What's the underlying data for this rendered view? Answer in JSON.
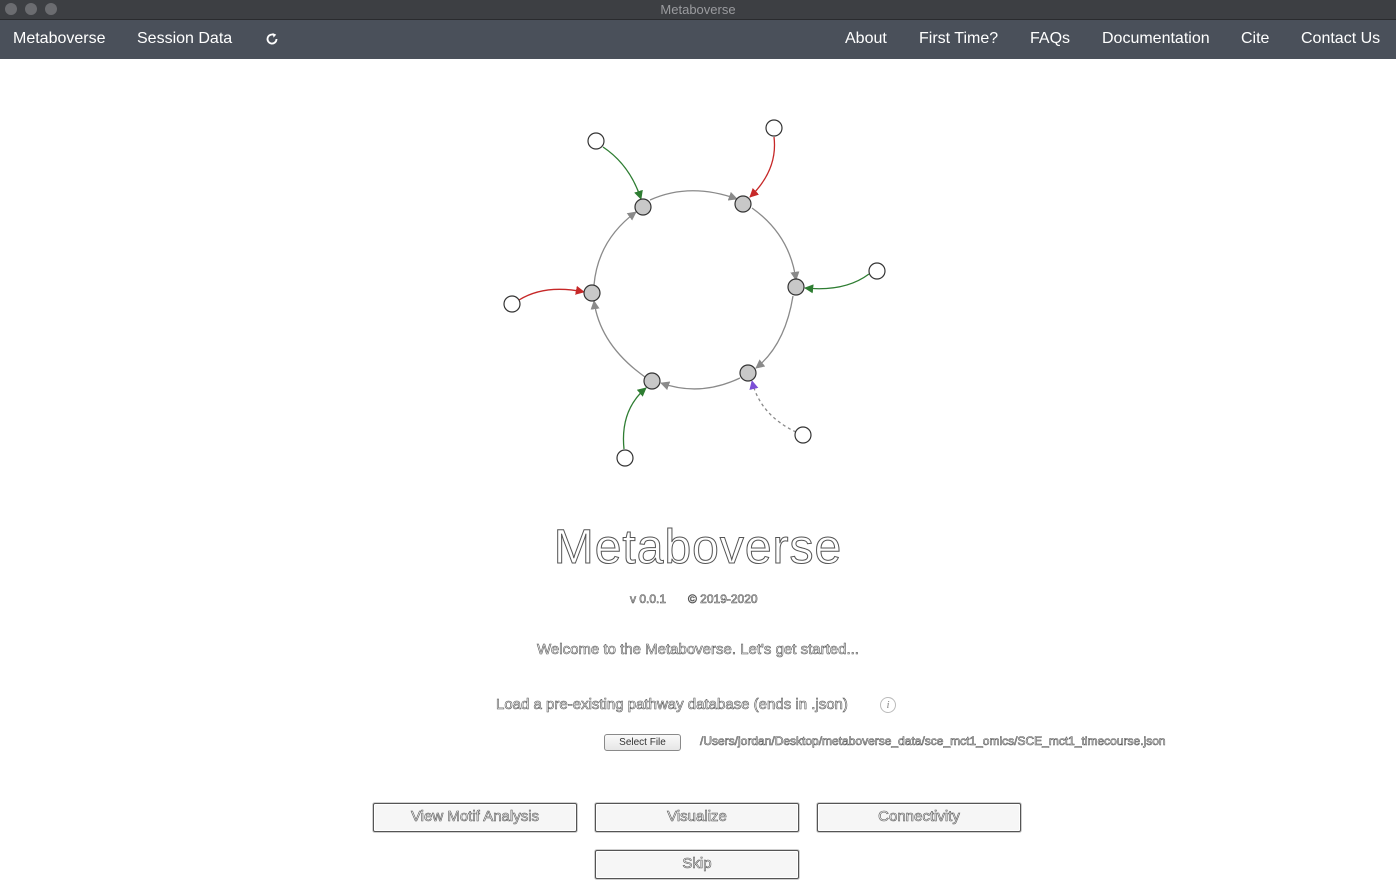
{
  "window": {
    "title": "Metaboverse"
  },
  "nav": {
    "left": [
      "Metaboverse",
      "Session Data"
    ],
    "right": [
      "About",
      "First Time?",
      "FAQs",
      "Documentation",
      "Cite",
      "Contact Us"
    ]
  },
  "hero": {
    "title": "Metaboverse",
    "version": "v 0.0.1",
    "copyright": "© 2019-2020",
    "welcome": "Welcome to the Metaboverse. Let's get started..."
  },
  "load": {
    "label": "Load a pre-existing pathway database (ends in .json)",
    "info_icon": "i",
    "select_label": "Select File",
    "file_path": "/Users/jordan/Desktop/metaboverse_data/sce_mct1_omics/SCE_mct1_timecourse.json"
  },
  "buttons": {
    "motif": "View Motif Analysis",
    "visualize": "Visualize",
    "connectivity": "Connectivity",
    "skip": "Skip"
  },
  "colors": {
    "navbar": "#4a505a",
    "edge_green": "#2e7d32",
    "edge_red": "#c62828",
    "edge_purple": "#7b4fd6",
    "edge_gray": "#8a8a8a",
    "node_fill": "#c8c8c8"
  }
}
